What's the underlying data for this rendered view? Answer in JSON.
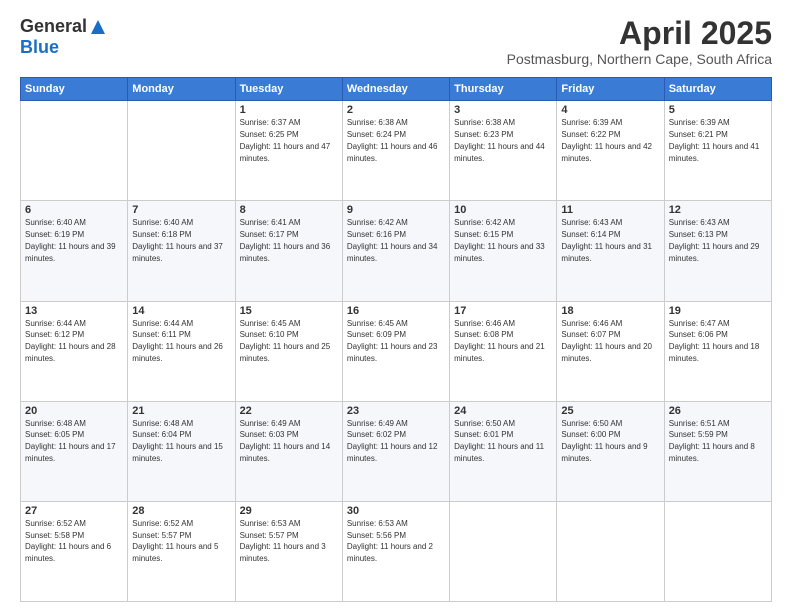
{
  "logo": {
    "general": "General",
    "blue": "Blue"
  },
  "header": {
    "month": "April 2025",
    "location": "Postmasburg, Northern Cape, South Africa"
  },
  "days": [
    "Sunday",
    "Monday",
    "Tuesday",
    "Wednesday",
    "Thursday",
    "Friday",
    "Saturday"
  ],
  "weeks": [
    [
      null,
      null,
      {
        "day": 1,
        "sunrise": "6:37 AM",
        "sunset": "6:25 PM",
        "daylight": "11 hours and 47 minutes."
      },
      {
        "day": 2,
        "sunrise": "6:38 AM",
        "sunset": "6:24 PM",
        "daylight": "11 hours and 46 minutes."
      },
      {
        "day": 3,
        "sunrise": "6:38 AM",
        "sunset": "6:23 PM",
        "daylight": "11 hours and 44 minutes."
      },
      {
        "day": 4,
        "sunrise": "6:39 AM",
        "sunset": "6:22 PM",
        "daylight": "11 hours and 42 minutes."
      },
      {
        "day": 5,
        "sunrise": "6:39 AM",
        "sunset": "6:21 PM",
        "daylight": "11 hours and 41 minutes."
      }
    ],
    [
      {
        "day": 6,
        "sunrise": "6:40 AM",
        "sunset": "6:19 PM",
        "daylight": "11 hours and 39 minutes."
      },
      {
        "day": 7,
        "sunrise": "6:40 AM",
        "sunset": "6:18 PM",
        "daylight": "11 hours and 37 minutes."
      },
      {
        "day": 8,
        "sunrise": "6:41 AM",
        "sunset": "6:17 PM",
        "daylight": "11 hours and 36 minutes."
      },
      {
        "day": 9,
        "sunrise": "6:42 AM",
        "sunset": "6:16 PM",
        "daylight": "11 hours and 34 minutes."
      },
      {
        "day": 10,
        "sunrise": "6:42 AM",
        "sunset": "6:15 PM",
        "daylight": "11 hours and 33 minutes."
      },
      {
        "day": 11,
        "sunrise": "6:43 AM",
        "sunset": "6:14 PM",
        "daylight": "11 hours and 31 minutes."
      },
      {
        "day": 12,
        "sunrise": "6:43 AM",
        "sunset": "6:13 PM",
        "daylight": "11 hours and 29 minutes."
      }
    ],
    [
      {
        "day": 13,
        "sunrise": "6:44 AM",
        "sunset": "6:12 PM",
        "daylight": "11 hours and 28 minutes."
      },
      {
        "day": 14,
        "sunrise": "6:44 AM",
        "sunset": "6:11 PM",
        "daylight": "11 hours and 26 minutes."
      },
      {
        "day": 15,
        "sunrise": "6:45 AM",
        "sunset": "6:10 PM",
        "daylight": "11 hours and 25 minutes."
      },
      {
        "day": 16,
        "sunrise": "6:45 AM",
        "sunset": "6:09 PM",
        "daylight": "11 hours and 23 minutes."
      },
      {
        "day": 17,
        "sunrise": "6:46 AM",
        "sunset": "6:08 PM",
        "daylight": "11 hours and 21 minutes."
      },
      {
        "day": 18,
        "sunrise": "6:46 AM",
        "sunset": "6:07 PM",
        "daylight": "11 hours and 20 minutes."
      },
      {
        "day": 19,
        "sunrise": "6:47 AM",
        "sunset": "6:06 PM",
        "daylight": "11 hours and 18 minutes."
      }
    ],
    [
      {
        "day": 20,
        "sunrise": "6:48 AM",
        "sunset": "6:05 PM",
        "daylight": "11 hours and 17 minutes."
      },
      {
        "day": 21,
        "sunrise": "6:48 AM",
        "sunset": "6:04 PM",
        "daylight": "11 hours and 15 minutes."
      },
      {
        "day": 22,
        "sunrise": "6:49 AM",
        "sunset": "6:03 PM",
        "daylight": "11 hours and 14 minutes."
      },
      {
        "day": 23,
        "sunrise": "6:49 AM",
        "sunset": "6:02 PM",
        "daylight": "11 hours and 12 minutes."
      },
      {
        "day": 24,
        "sunrise": "6:50 AM",
        "sunset": "6:01 PM",
        "daylight": "11 hours and 11 minutes."
      },
      {
        "day": 25,
        "sunrise": "6:50 AM",
        "sunset": "6:00 PM",
        "daylight": "11 hours and 9 minutes."
      },
      {
        "day": 26,
        "sunrise": "6:51 AM",
        "sunset": "5:59 PM",
        "daylight": "11 hours and 8 minutes."
      }
    ],
    [
      {
        "day": 27,
        "sunrise": "6:52 AM",
        "sunset": "5:58 PM",
        "daylight": "11 hours and 6 minutes."
      },
      {
        "day": 28,
        "sunrise": "6:52 AM",
        "sunset": "5:57 PM",
        "daylight": "11 hours and 5 minutes."
      },
      {
        "day": 29,
        "sunrise": "6:53 AM",
        "sunset": "5:57 PM",
        "daylight": "11 hours and 3 minutes."
      },
      {
        "day": 30,
        "sunrise": "6:53 AM",
        "sunset": "5:56 PM",
        "daylight": "11 hours and 2 minutes."
      },
      null,
      null,
      null
    ]
  ]
}
